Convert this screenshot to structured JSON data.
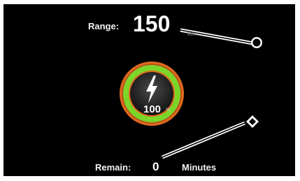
{
  "range": {
    "label": "Range:",
    "value": "150",
    "unit": "km"
  },
  "battery": {
    "percent_text": "100",
    "percent_sign": "%",
    "level": 1.0,
    "icon": "lightning-bolt-icon",
    "ring_color": "#7bd62a",
    "outer_color": "#e06a1e"
  },
  "remain": {
    "label": "Remain:",
    "value": "0",
    "unit": "Minutes"
  },
  "handles": {
    "range_handle": "circle-handle-icon",
    "remain_handle": "diamond-handle-icon"
  }
}
